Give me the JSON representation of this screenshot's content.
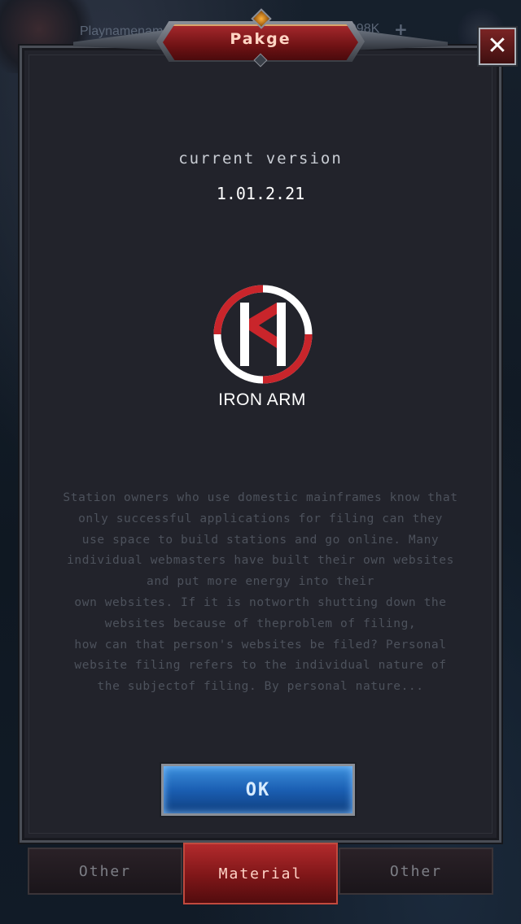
{
  "hud": {
    "player_name": "Playnamename",
    "currency": "9098K",
    "plus": "+"
  },
  "dialog": {
    "title": "Pakge",
    "close": "✕",
    "version_label": "current version",
    "version_value": "1.01.2.21",
    "brand_name": "IRON ARM",
    "description_lines": [
      "Station owners who use domestic mainframes know that",
      "only successful applications for filing can they",
      "use space to build stations and go online. Many",
      "individual webmasters have built their own websites",
      "and put more energy into their",
      "own websites. If it is notworth shutting down the",
      "websites because of theproblem of filing,",
      "how can that person's websites be filed? Personal",
      "website filing refers to the individual nature of",
      "the subjectof filing. By personal nature..."
    ],
    "ok_label": "OK"
  },
  "tabs": [
    {
      "label": "Other",
      "active": false
    },
    {
      "label": "Material",
      "active": true
    },
    {
      "label": "Other",
      "active": false
    }
  ],
  "colors": {
    "accent_red": "#a3272b",
    "button_blue": "#1b5fb3",
    "panel_bg": "#22232b"
  },
  "icons": {
    "logo": "iron-arm-logo",
    "close": "close-icon",
    "currency_add": "plus-icon"
  }
}
